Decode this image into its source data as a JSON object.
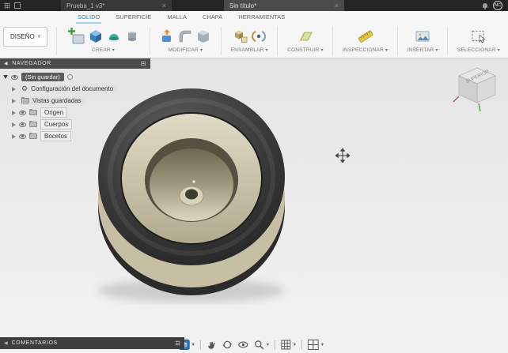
{
  "titlebar": {
    "tabs": [
      {
        "label": "Prueba_1 v3*"
      },
      {
        "label": "Sin título*"
      }
    ],
    "avatar": "MC"
  },
  "ribbon": {
    "workspace": {
      "label": "DISEÑO"
    },
    "tabs": [
      {
        "label": "SOLIDO"
      },
      {
        "label": "SUPERFICIE"
      },
      {
        "label": "MALLA"
      },
      {
        "label": "CHAPA"
      },
      {
        "label": "HERRAMIENTAS"
      }
    ],
    "groups": [
      {
        "label": "CREAR"
      },
      {
        "label": "MODIFICAR"
      },
      {
        "label": "ENSAMBLAR"
      },
      {
        "label": "CONSTRUIR"
      },
      {
        "label": "INSPECCIONAR"
      },
      {
        "label": "INSERTAR"
      },
      {
        "label": "SELECCIONAR"
      }
    ]
  },
  "navigator": {
    "title": "NAVEGADOR",
    "root_label": "(Sin guardar)",
    "items": [
      {
        "label": "Configuración del documento"
      },
      {
        "label": "Vistas guardadas"
      },
      {
        "label": "Origen"
      },
      {
        "label": "Cuerpos"
      },
      {
        "label": "Bocetos"
      }
    ]
  },
  "viewcube": {
    "top_face": "SUPERIOR"
  },
  "comments": {
    "title": "COMENTARIOS"
  },
  "glyphs": {
    "caret_down": "▾",
    "collapse_left": "◀",
    "close": "×",
    "gear": "⚙",
    "panel_toggle": "⊟"
  },
  "colors": {
    "accent_blue": "#0696d7",
    "tire_dark": "#2e2e2e",
    "hub_cream": "#d6d0b8"
  }
}
